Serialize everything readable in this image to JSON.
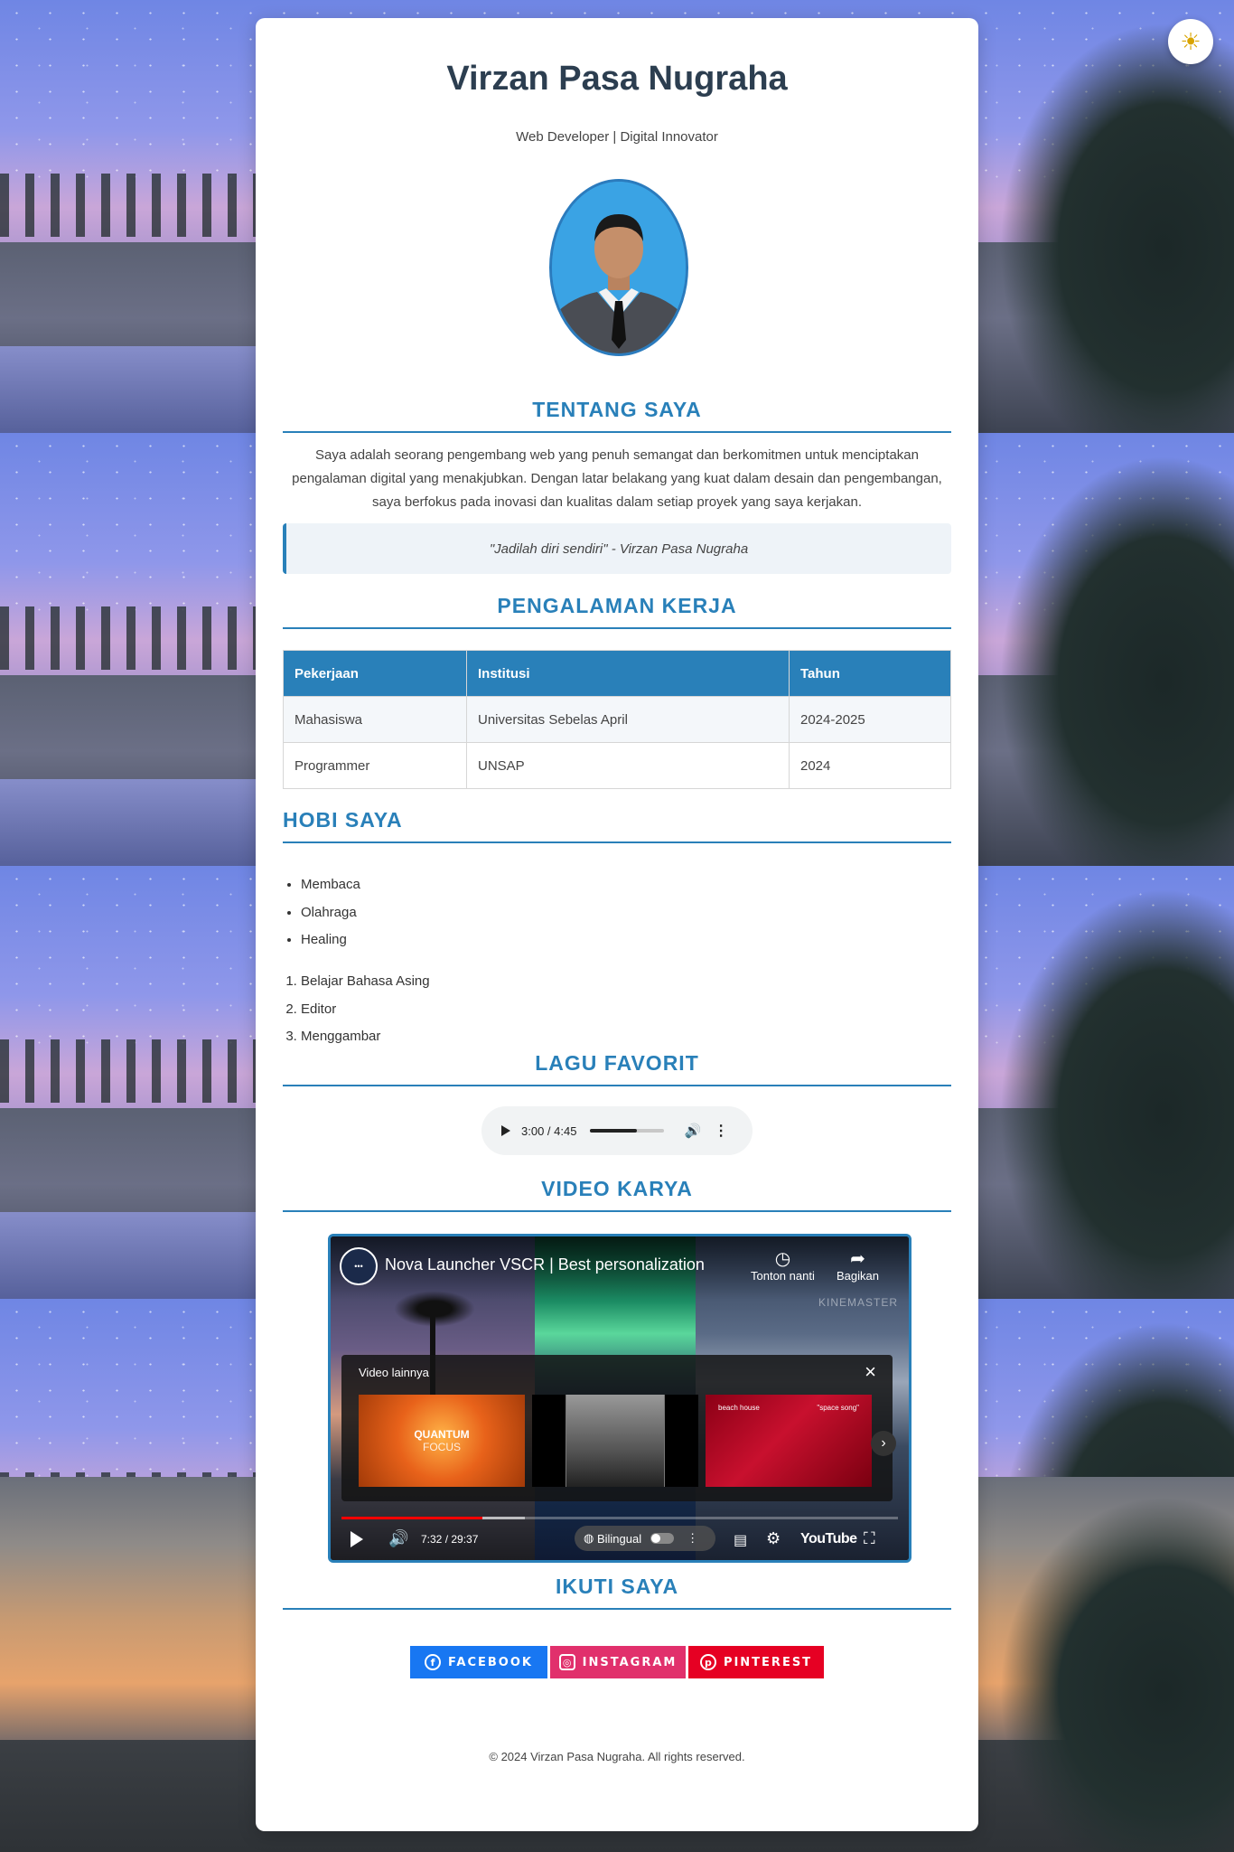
{
  "header": {
    "name": "Virzan Pasa Nugraha",
    "tagline": "Web Developer | Digital Innovator"
  },
  "theme_toggle": {
    "icon": "sun-icon",
    "glyph": "☀"
  },
  "about": {
    "title": "TENTANG SAYA",
    "text": "Saya adalah seorang pengembang web yang penuh semangat dan berkomitmen untuk menciptakan pengalaman digital yang menakjubkan. Dengan latar belakang yang kuat dalam desain dan pengembangan, saya berfokus pada inovasi dan kualitas dalam setiap proyek yang saya kerjakan.",
    "quote": "\"Jadilah diri sendiri\" - Virzan Pasa Nugraha"
  },
  "experience": {
    "title": "PENGALAMAN KERJA",
    "headers": [
      "Pekerjaan",
      "Institusi",
      "Tahun"
    ],
    "rows": [
      [
        "Mahasiswa",
        "Universitas Sebelas April",
        "2024-2025"
      ],
      [
        "Programmer",
        "UNSAP",
        "2024"
      ]
    ]
  },
  "hobbies": {
    "title": "HOBI SAYA",
    "unordered": [
      "Membaca",
      "Olahraga",
      "Healing"
    ],
    "ordered": [
      "Belajar Bahasa Asing",
      "Editor",
      "Menggambar"
    ]
  },
  "music": {
    "title": "LAGU FAVORIT",
    "time": "3:00 / 4:45",
    "progress": 0.63
  },
  "video": {
    "title": "VIDEO KARYA",
    "video_title": "Nova Launcher VSCR | Best personalization",
    "watch_later": "Tonton nanti",
    "share": "Bagikan",
    "watermark": "KINEMASTER",
    "more_videos": "Video lainnya",
    "thumb1_title": "QUANTUM",
    "thumb1_sub": "FOCUS",
    "thumb3_left": "beach house",
    "thumb3_right": "\"space song\"",
    "time": "7:32 / 29:37",
    "played": 0.254,
    "buffered": 0.33,
    "bilingual": "Bilingual",
    "logo": "YouTube"
  },
  "social": {
    "title": "IKUTI SAYA",
    "facebook": "FACEBOOK",
    "instagram": "INSTAGRAM",
    "pinterest": "PINTEREST",
    "colors": {
      "facebook": "#1877f2",
      "instagram": "#e1306c",
      "pinterest": "#e60023"
    }
  },
  "footer": "© 2024 Virzan Pasa Nugraha. All rights reserved.",
  "colors": {
    "accent": "#2980b9",
    "heading": "#2c3e50"
  }
}
